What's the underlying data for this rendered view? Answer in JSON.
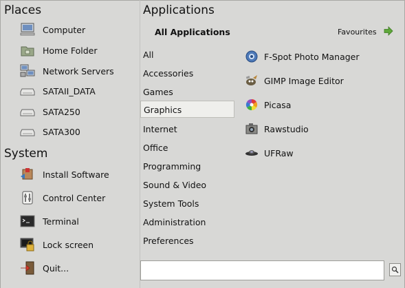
{
  "places": {
    "title": "Places",
    "items": [
      {
        "label": "Computer",
        "icon": "computer-icon"
      },
      {
        "label": "Home Folder",
        "icon": "home-folder-icon"
      },
      {
        "label": "Network Servers",
        "icon": "network-servers-icon"
      },
      {
        "label": "SATAII_DATA",
        "icon": "drive-icon"
      },
      {
        "label": "SATA250",
        "icon": "drive-icon"
      },
      {
        "label": "SATA300",
        "icon": "drive-icon"
      }
    ]
  },
  "system": {
    "title": "System",
    "items": [
      {
        "label": "Install Software",
        "icon": "install-software-icon"
      },
      {
        "label": "Control Center",
        "icon": "control-center-icon"
      },
      {
        "label": "Terminal",
        "icon": "terminal-icon"
      },
      {
        "label": "Lock screen",
        "icon": "lock-screen-icon"
      },
      {
        "label": "Quit...",
        "icon": "quit-icon"
      }
    ]
  },
  "applications": {
    "title": "Applications",
    "all_label": "All Applications",
    "favourites_label": "Favourites",
    "categories": [
      "All",
      "Accessories",
      "Games",
      "Graphics",
      "Internet",
      "Office",
      "Programming",
      "Sound & Video",
      "System Tools",
      "Administration",
      "Preferences"
    ],
    "selected_category": "Graphics",
    "apps": [
      {
        "label": "F-Spot Photo Manager",
        "icon": "fspot-icon"
      },
      {
        "label": "GIMP Image Editor",
        "icon": "gimp-icon"
      },
      {
        "label": "Picasa",
        "icon": "picasa-icon"
      },
      {
        "label": "Rawstudio",
        "icon": "rawstudio-icon"
      },
      {
        "label": "UFRaw",
        "icon": "ufraw-icon"
      }
    ]
  },
  "search": {
    "value": "",
    "placeholder": ""
  },
  "colors": {
    "background": "#d8d8d6",
    "selected_bg": "#efefec",
    "favourites_arrow": "#5fa83a"
  }
}
